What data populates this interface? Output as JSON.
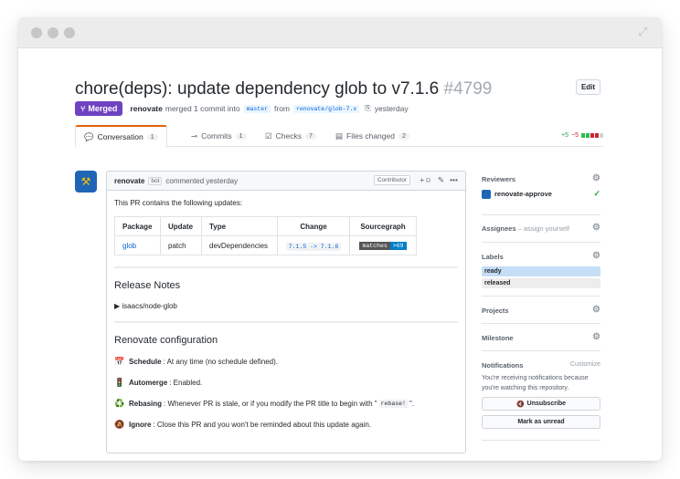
{
  "icons": {
    "expand": "expand-icon",
    "merge": "git-merge-icon",
    "copy": "clipboard-icon",
    "conversation": "comment-discussion-icon",
    "commits": "git-commit-icon",
    "checks": "checklist-icon",
    "files": "file-diff-icon",
    "reaction": "smiley-icon",
    "edit": "pencil-icon",
    "more": "kebab-horizontal-icon"
  },
  "pr": {
    "title": "chore(deps): update dependency glob to v7.1.6",
    "number": "#4799",
    "edit_label": "Edit",
    "state_label": "Merged",
    "author": "renovate",
    "merge_text": "merged 1 commit into",
    "base_branch": "master",
    "from_text": "from",
    "head_branch": "renovate/glob-7.x",
    "time": "yesterday"
  },
  "tabs": [
    {
      "label": "Conversation",
      "count": "1"
    },
    {
      "label": "Commits",
      "count": "1"
    },
    {
      "label": "Checks",
      "count": "7"
    },
    {
      "label": "Files changed",
      "count": "2"
    }
  ],
  "diffstat": {
    "additions": "+5",
    "deletions": "−5",
    "colors": [
      "#2cbe4e",
      "#2cbe4e",
      "#cb2431",
      "#cb2431",
      "#d1d5da"
    ]
  },
  "comment": {
    "author": "renovate",
    "bot_label": "bot",
    "action": "commented yesterday",
    "role": "Contributor",
    "reaction_label": "+☺",
    "intro": "This PR contains the following updates:",
    "table": {
      "headers": [
        "Package",
        "Update",
        "Type",
        "Change",
        "Sourcegraph"
      ],
      "row": {
        "package": "glob",
        "update": "patch",
        "type": "devDependencies",
        "change": "7.1.5 -> 7.1.6",
        "badge_left": "matches",
        "badge_right": ">69"
      }
    },
    "release_notes_heading": "Release Notes",
    "release_item": "isaacs/node-glob",
    "config_heading": "Renovate configuration",
    "config": [
      {
        "emoji": "📅",
        "title": "Schedule",
        "text": ": At any time (no schedule defined)."
      },
      {
        "emoji": "🚦",
        "title": "Automerge",
        "text": ": Enabled."
      },
      {
        "emoji": "♻️",
        "title": "Rebasing",
        "text": ": Whenever PR is stale, or if you modify the PR title to begin with \"",
        "code": "rebase!",
        "after": "\"."
      },
      {
        "emoji": "🔕",
        "title": "Ignore",
        "text": ": Close this PR and you won't be reminded about this update again."
      }
    ]
  },
  "sidebar": {
    "reviewers_title": "Reviewers",
    "reviewer": "renovate-approve",
    "assignees_title": "Assignees",
    "assignees_hint": "– assign yourself",
    "labels_title": "Labels",
    "labels": [
      {
        "name": "ready",
        "color": "#c5def5"
      },
      {
        "name": "released",
        "color": "#ededed"
      }
    ],
    "projects_title": "Projects",
    "milestone_title": "Milestone",
    "notifications_title": "Notifications",
    "customize_label": "Customize",
    "notifications_text": "You're receiving notifications because you're watching this repository.",
    "unsubscribe_label": "Unsubscribe",
    "mark_unread_label": "Mark as unread"
  }
}
